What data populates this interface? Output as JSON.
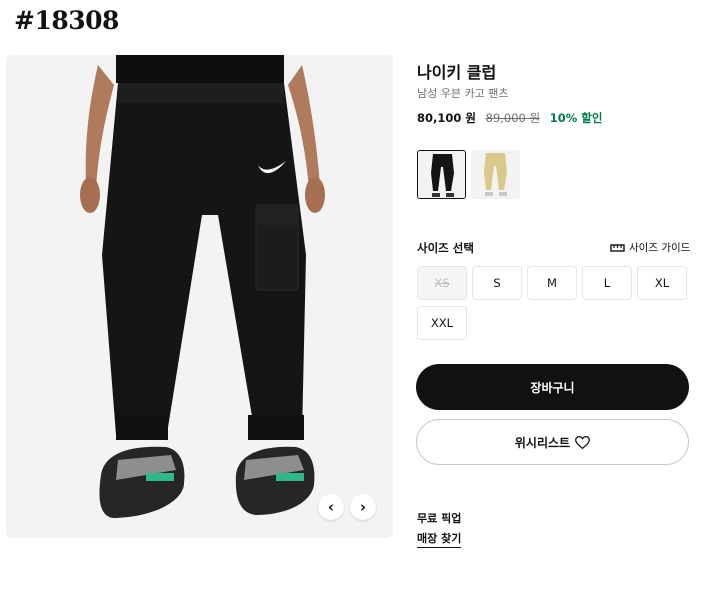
{
  "post_tag": "#18308",
  "product": {
    "title": "나이키 클럽",
    "subtitle": "남성 우븐 카고 팬츠",
    "price": "80,100 원",
    "original_price": "89,000 원",
    "discount": "10% 할인"
  },
  "colorways": [
    {
      "name": "black",
      "selected": true,
      "color": "#111111"
    },
    {
      "name": "khaki",
      "selected": false,
      "color": "#d9c98a"
    }
  ],
  "sizes": {
    "label": "사이즈 선택",
    "guide_label": "사이즈 가이드",
    "options": [
      {
        "label": "XS",
        "available": false
      },
      {
        "label": "S",
        "available": true
      },
      {
        "label": "M",
        "available": true
      },
      {
        "label": "L",
        "available": true
      },
      {
        "label": "XL",
        "available": true
      },
      {
        "label": "XXL",
        "available": true
      }
    ]
  },
  "actions": {
    "cart_label": "장바구니",
    "wishlist_label": "위시리스트"
  },
  "pickup": {
    "label": "무료 픽업",
    "store_link": "매장 찾기"
  },
  "carousel": {
    "prev_icon": "chevron-left-icon",
    "next_icon": "chevron-right-icon"
  },
  "colors": {
    "accent_discount": "#007d48",
    "button_dark": "#111111"
  }
}
